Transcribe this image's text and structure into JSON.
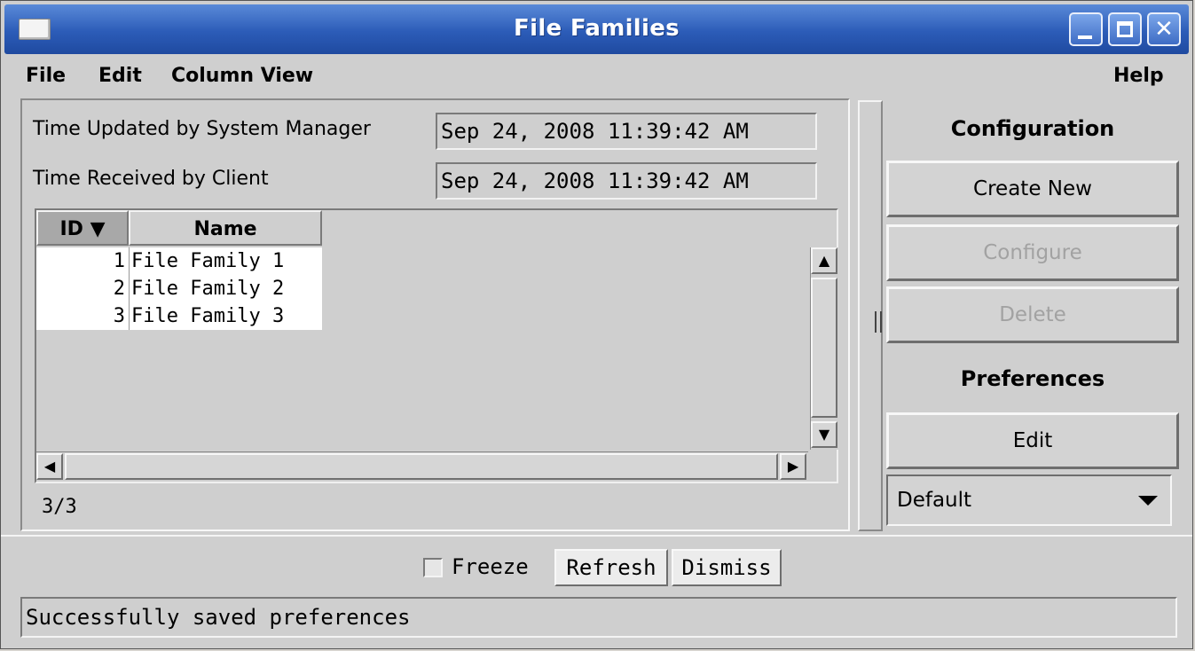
{
  "window": {
    "title": "File Families"
  },
  "menubar": {
    "file": "File",
    "edit": "Edit",
    "column_view": "Column View",
    "help": "Help"
  },
  "times": {
    "updated_label": "Time Updated by System Manager",
    "updated_value": "Sep 24, 2008 11:39:42 AM",
    "received_label": "Time Received by Client",
    "received_value": "Sep 24, 2008 11:39:42 AM"
  },
  "table": {
    "columns": [
      "ID ▼",
      "Name"
    ],
    "rows": [
      {
        "id": "1",
        "name": "File Family 1"
      },
      {
        "id": "2",
        "name": "File Family 2"
      },
      {
        "id": "3",
        "name": "File Family 3"
      }
    ],
    "count": "3/3"
  },
  "sidebar": {
    "configuration_label": "Configuration",
    "create_new": "Create New",
    "configure": "Configure",
    "delete": "Delete",
    "preferences_label": "Preferences",
    "edit": "Edit",
    "preset_selected": "Default"
  },
  "bottom": {
    "freeze_label": "Freeze",
    "refresh": "Refresh",
    "dismiss": "Dismiss"
  },
  "status": {
    "message": "Successfully saved preferences"
  },
  "icons": {
    "minimize": "minimize-icon",
    "maximize": "maximize-icon",
    "close": "close-icon",
    "window_menu": "window-menu-icon",
    "scroll_up": "arrow-up-icon",
    "scroll_down": "arrow-down-icon",
    "scroll_left": "arrow-left-icon",
    "scroll_right": "arrow-right-icon",
    "combo_arrow": "chevron-down-icon",
    "sort": "sort-descending-icon"
  },
  "colors": {
    "titlebar": "#2c5cb8",
    "panel": "#cfcfcf",
    "disabled_text": "#a2a2a2"
  }
}
